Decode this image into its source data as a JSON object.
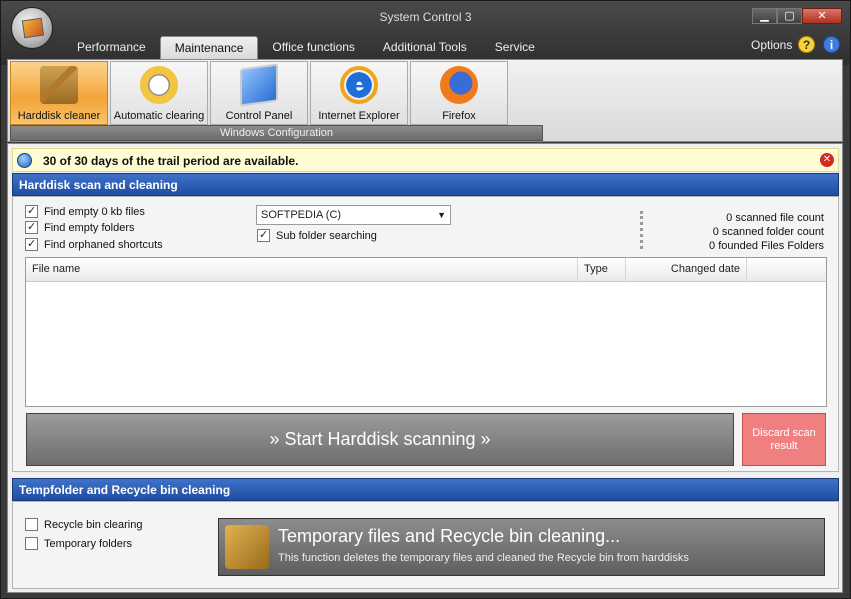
{
  "window": {
    "title": "System Control 3"
  },
  "tabs": [
    "Performance",
    "Maintenance",
    "Office functions",
    "Additional Tools",
    "Service"
  ],
  "active_tab": "Maintenance",
  "header": {
    "options_label": "Options"
  },
  "ribbon": {
    "buttons": [
      {
        "label": "Harddisk cleaner",
        "icon": "broom-icon"
      },
      {
        "label": "Automatic clearing",
        "icon": "clock-icon"
      },
      {
        "label": "Control Panel",
        "icon": "control-panel-icon"
      },
      {
        "label": "Internet Explorer",
        "icon": "internet-explorer-icon"
      },
      {
        "label": "Firefox",
        "icon": "firefox-icon"
      }
    ],
    "group_label": "Windows Configuration"
  },
  "notice": {
    "text": "30 of 30 days of the trail period are available."
  },
  "scan_section": {
    "title": "Harddisk scan and cleaning",
    "options": [
      {
        "label": "Find empty 0 kb files",
        "checked": true
      },
      {
        "label": "Find empty folders",
        "checked": true
      },
      {
        "label": "Find orphaned shortcuts",
        "checked": true
      }
    ],
    "drive": "SOFTPEDIA (C)",
    "subfolder": {
      "label": "Sub folder searching",
      "checked": true
    },
    "stats": [
      "0 scanned file count",
      "0 scanned folder count",
      "0 founded Files  Folders"
    ],
    "columns": [
      "File name",
      "Type",
      "Changed date"
    ],
    "scan_button": "» Start Harddisk scanning »",
    "discard_button_line1": "Discard scan",
    "discard_button_line2": "result"
  },
  "temp_section": {
    "title": "Tempfolder and Recycle bin cleaning",
    "options": [
      {
        "label": "Recycle bin clearing",
        "checked": false
      },
      {
        "label": "Temporary folders",
        "checked": false
      }
    ],
    "button_title": "Temporary files and Recycle bin cleaning...",
    "button_desc": "This function deletes the temporary files and cleaned the Recycle bin from harddisks"
  }
}
